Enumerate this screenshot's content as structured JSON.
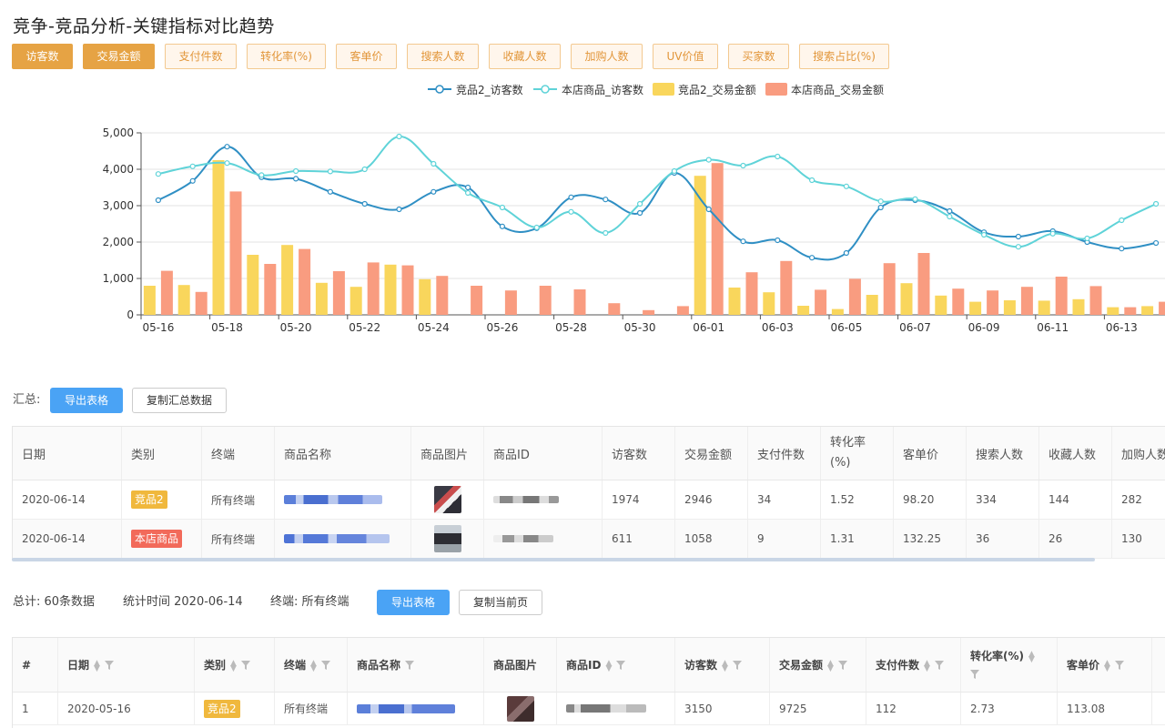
{
  "page_title": "竞争-竞品分析-关键指标对比趋势",
  "metric_buttons": [
    {
      "label": "访客数",
      "active": true
    },
    {
      "label": "交易金额",
      "active": true
    },
    {
      "label": "支付件数",
      "active": false
    },
    {
      "label": "转化率(%)",
      "active": false
    },
    {
      "label": "客单价",
      "active": false
    },
    {
      "label": "搜索人数",
      "active": false
    },
    {
      "label": "收藏人数",
      "active": false
    },
    {
      "label": "加购人数",
      "active": false
    },
    {
      "label": "UV价值",
      "active": false
    },
    {
      "label": "买家数",
      "active": false
    },
    {
      "label": "搜索占比(%)",
      "active": false
    }
  ],
  "chart_data": {
    "type": "bar",
    "legend_position": "top",
    "grid": true,
    "ylim": [
      0,
      5000
    ],
    "y_ticks": [
      "0",
      "1,000",
      "2,000",
      "3,000",
      "4,000",
      "5,000"
    ],
    "x_ticks": [
      "05-16",
      "05-18",
      "05-20",
      "05-22",
      "05-24",
      "05-26",
      "05-28",
      "05-30",
      "06-01",
      "06-03",
      "06-05",
      "06-07",
      "06-09",
      "06-11",
      "06-13"
    ],
    "categories": [
      "05-16",
      "05-17",
      "05-18",
      "05-19",
      "05-20",
      "05-21",
      "05-22",
      "05-23",
      "05-24",
      "05-25",
      "05-26",
      "05-27",
      "05-28",
      "05-29",
      "05-30",
      "05-31",
      "06-01",
      "06-02",
      "06-03",
      "06-04",
      "06-05",
      "06-06",
      "06-07",
      "06-08",
      "06-09",
      "06-10",
      "06-11",
      "06-12",
      "06-13",
      "06-14"
    ],
    "series": [
      {
        "name": "竞品2_访客数",
        "kind": "line",
        "color": "#2f8fc4",
        "values": [
          3150,
          3680,
          4620,
          3780,
          3740,
          3380,
          3050,
          2900,
          3380,
          3500,
          2430,
          2380,
          3230,
          3170,
          2800,
          3900,
          2900,
          2020,
          2050,
          1570,
          1700,
          2950,
          3150,
          2850,
          2270,
          2150,
          2300,
          2000,
          1820,
          1974
        ]
      },
      {
        "name": "本店商品_访客数",
        "kind": "line",
        "color": "#5fd3d8",
        "values": [
          3870,
          4080,
          4170,
          3840,
          3950,
          3940,
          4000,
          4900,
          4150,
          3350,
          2950,
          2400,
          2830,
          2250,
          3050,
          3950,
          4260,
          4100,
          4350,
          3700,
          3530,
          3120,
          3180,
          2700,
          2200,
          1870,
          2230,
          2100,
          2600,
          3050
        ]
      },
      {
        "name": "竞品2_交易金额",
        "kind": "bar",
        "color": "#f9d65c",
        "values": [
          800,
          820,
          4250,
          1650,
          1920,
          880,
          770,
          1380,
          980,
          0,
          0,
          0,
          0,
          0,
          0,
          0,
          3820,
          750,
          620,
          250,
          160,
          550,
          870,
          530,
          360,
          400,
          390,
          430,
          210,
          240
        ]
      },
      {
        "name": "本店商品_交易金额",
        "kind": "bar",
        "color": "#f99c80",
        "values": [
          1210,
          630,
          3390,
          1400,
          1810,
          1200,
          1440,
          1360,
          1070,
          800,
          670,
          800,
          700,
          320,
          130,
          240,
          4170,
          1170,
          1480,
          690,
          990,
          1420,
          1700,
          720,
          670,
          770,
          1050,
          790,
          210,
          360
        ]
      }
    ]
  },
  "summary": {
    "label": "汇总:",
    "export_btn": "导出表格",
    "copy_btn": "复制汇总数据",
    "columns": [
      "日期",
      "类别",
      "终端",
      "商品名称",
      "商品图片",
      "商品ID",
      "访客数",
      "交易金额",
      "支付件数",
      "转化率",
      "(%)",
      "客单价",
      "搜索人数",
      "收藏人数",
      "加购人数"
    ],
    "rows": [
      {
        "date": "2020-06-14",
        "category": "竞品2",
        "cat_type": "comp",
        "terminal": "所有终端",
        "visitors": "1974",
        "amount": "2946",
        "pieces": "34",
        "conv": "1.52",
        "unit_price": "98.20",
        "search": "334",
        "fav": "144",
        "cart": "282"
      },
      {
        "date": "2020-06-14",
        "category": "本店商品",
        "cat_type": "own",
        "terminal": "所有终端",
        "visitors": "611",
        "amount": "1058",
        "pieces": "9",
        "conv": "1.31",
        "unit_price": "132.25",
        "search": "36",
        "fav": "26",
        "cart": "130"
      }
    ]
  },
  "totals": {
    "count": "总计: 60条数据",
    "time": "统计时间 2020-06-14",
    "terminal": "终端: 所有终端",
    "export_btn": "导出表格",
    "copy_btn": "复制当前页"
  },
  "detail": {
    "columns": [
      "#",
      "日期",
      "类别",
      "终端",
      "商品名称",
      "商品图片",
      "商品ID",
      "访客数",
      "交易金额",
      "支付件数",
      "转化率(%)",
      "客单价"
    ],
    "rows": [
      {
        "index": "1",
        "date": "2020-05-16",
        "category": "竞品2",
        "terminal": "所有终端",
        "visitors": "3150",
        "amount": "9725",
        "pieces": "112",
        "conv": "2.73",
        "unit_price": "113.08"
      }
    ]
  }
}
